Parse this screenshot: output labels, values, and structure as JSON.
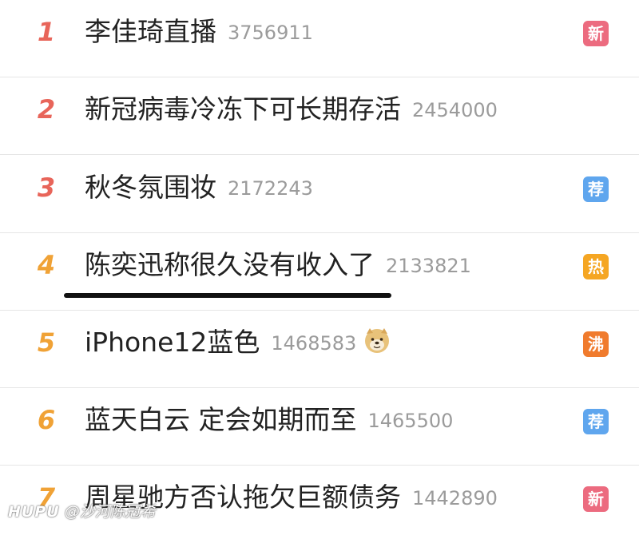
{
  "hot_list": {
    "items": [
      {
        "rank": "1",
        "title": "李佳琦直播",
        "count": "3756911",
        "badge": "新",
        "badge_color": "#ec6b7f"
      },
      {
        "rank": "2",
        "title": "新冠病毒冷冻下可长期存活",
        "count": "2454000",
        "badge": "",
        "badge_color": ""
      },
      {
        "rank": "3",
        "title": "秋冬氛围妆",
        "count": "2172243",
        "badge": "荐",
        "badge_color": "#5fa6ee"
      },
      {
        "rank": "4",
        "title": "陈奕迅称很久没有收入了",
        "count": "2133821",
        "badge": "热",
        "badge_color": "#f5a623"
      },
      {
        "rank": "5",
        "title": "iPhone12蓝色",
        "count": "1468583",
        "badge": "沸",
        "badge_color": "#f07b2d",
        "emoji": "doge-emoji"
      },
      {
        "rank": "6",
        "title": "蓝天白云 定会如期而至",
        "count": "1465500",
        "badge": "荐",
        "badge_color": "#5fa6ee"
      },
      {
        "rank": "7",
        "title": "周星驰方否认拖欠巨额债务",
        "count": "1442890",
        "badge": "新",
        "badge_color": "#ec6b7f"
      }
    ]
  },
  "watermark": {
    "brand": "HUPU",
    "handle": "@沙河陈冠希"
  },
  "colors": {
    "rank_top": "#e8655a",
    "rank_mid": "#f0a236",
    "title": "#222222",
    "count": "#9b9b9b",
    "divider": "#e6e6e6"
  }
}
